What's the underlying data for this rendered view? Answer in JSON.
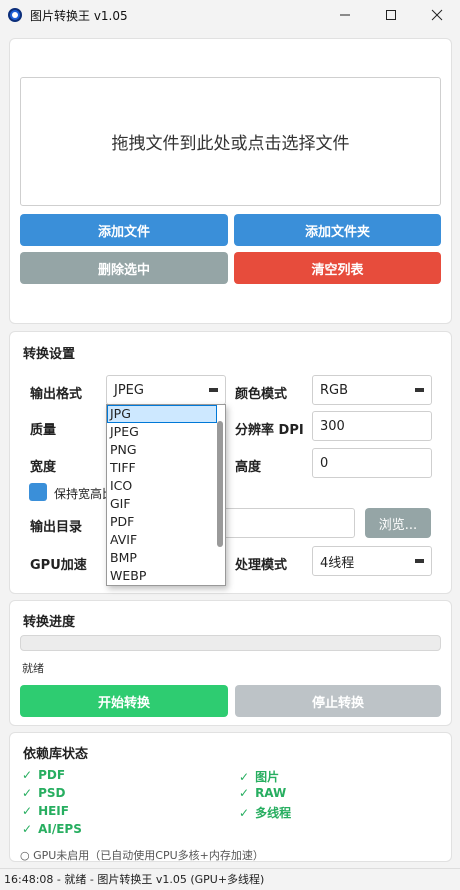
{
  "window": {
    "title": "图片转换王 v1.05"
  },
  "files": {
    "dropzone_text": "拖拽文件到此处或点击选择文件",
    "add_files": "添加文件",
    "add_folder": "添加文件夹",
    "remove_selected": "删除选中",
    "clear_list": "清空列表"
  },
  "settings": {
    "title": "转换设置",
    "format_label": "输出格式",
    "format_value": "JPEG",
    "color_mode_label": "颜色模式",
    "color_mode_value": "RGB",
    "quality_label": "质量",
    "dpi_label": "分辨率 DPI",
    "dpi_value": "300",
    "width_label": "宽度",
    "height_label": "高度",
    "height_value": "0",
    "keep_ratio_label": "保持宽高比",
    "output_dir_label": "输出目录",
    "browse_label": "浏览...",
    "gpu_label": "GPU加速",
    "mode_label": "处理模式",
    "mode_value": "4线程",
    "format_options": [
      "JPG",
      "JPEG",
      "PNG",
      "TIFF",
      "ICO",
      "GIF",
      "PDF",
      "AVIF",
      "BMP",
      "WEBP"
    ],
    "selected_option": "JPG"
  },
  "progress": {
    "title": "转换进度",
    "status": "就绪",
    "value": 0,
    "start_label": "开始转换",
    "stop_label": "停止转换"
  },
  "deps": {
    "title": "依赖库状态",
    "check": "✓",
    "items": [
      "PDF",
      "图片",
      "PSD",
      "RAW",
      "HEIF",
      "多线程",
      "AI/EPS"
    ],
    "gpu_note": "○ GPU未启用（已自动使用CPU多核+内存加速）"
  },
  "statusbar": {
    "text": "16:48:08 - 就绪 - 图片转换王 v1.05 (GPU+多线程)"
  },
  "colors": {
    "blue": "#3a8fd9",
    "gray": "#95a5a6",
    "red": "#e74c3c",
    "green": "#2ecc71",
    "disabled": "#bdc3c7",
    "ok_green": "#27ae60"
  }
}
